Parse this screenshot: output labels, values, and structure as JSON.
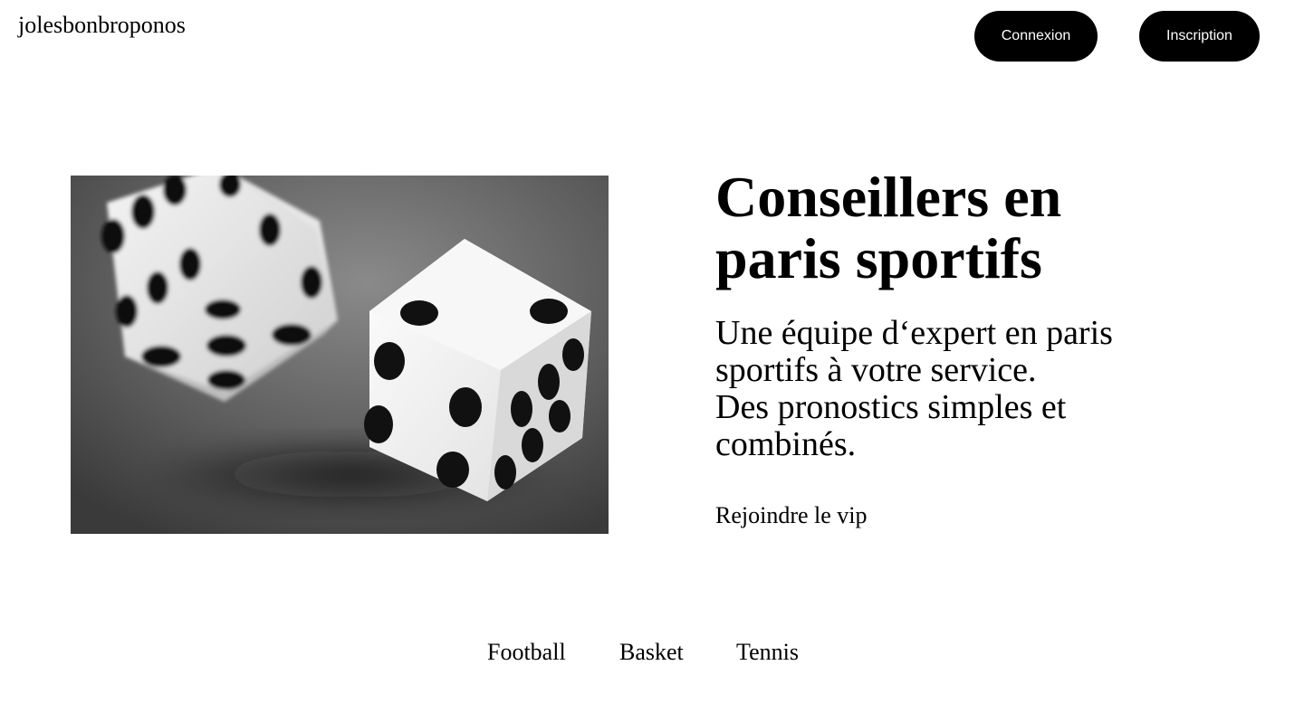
{
  "header": {
    "brand": "jolesbonbroponos",
    "login_label": "Connexion",
    "signup_label": "Inscription"
  },
  "hero": {
    "image_icon": "dice-photo",
    "title": "Conseillers en\nparis sportifs",
    "description": "Une équipe d‘expert en paris sportifs à votre service.\nDes pronostics simples et combinés.",
    "cta_label": "Rejoindre le vip"
  },
  "sports_nav": {
    "items": [
      "Football",
      "Basket",
      "Tennis"
    ]
  },
  "colors": {
    "background": "#ffffff",
    "text": "#000000",
    "button_bg": "#000000",
    "button_text": "#ffffff"
  }
}
